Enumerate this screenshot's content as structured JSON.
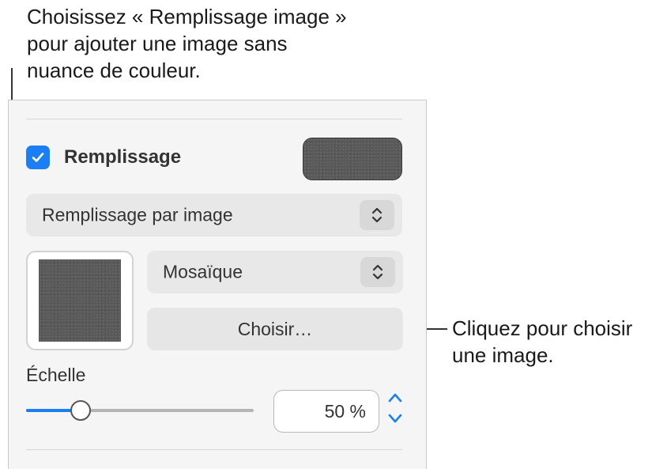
{
  "callouts": {
    "top": "Choisissez « Remplissage image »\npour ajouter une image sans\nnuance de couleur.",
    "right": "Cliquez pour choisir\nune image."
  },
  "fill": {
    "checked": true,
    "label": "Remplissage",
    "fill_type": "Remplissage par image",
    "tiling": "Mosaïque",
    "choose_label": "Choisir…"
  },
  "scale": {
    "label": "Échelle",
    "value_text": "50 %",
    "slider_fraction": 0.24
  },
  "colors": {
    "accent": "#1a7ff5",
    "panel_bg": "#f5f5f5",
    "control_bg": "#e8e8e8",
    "swatch": "#5a5a5a"
  },
  "icons": [
    "checkmark-icon",
    "chevron-updown-icon",
    "chevron-up-icon",
    "chevron-down-icon"
  ]
}
